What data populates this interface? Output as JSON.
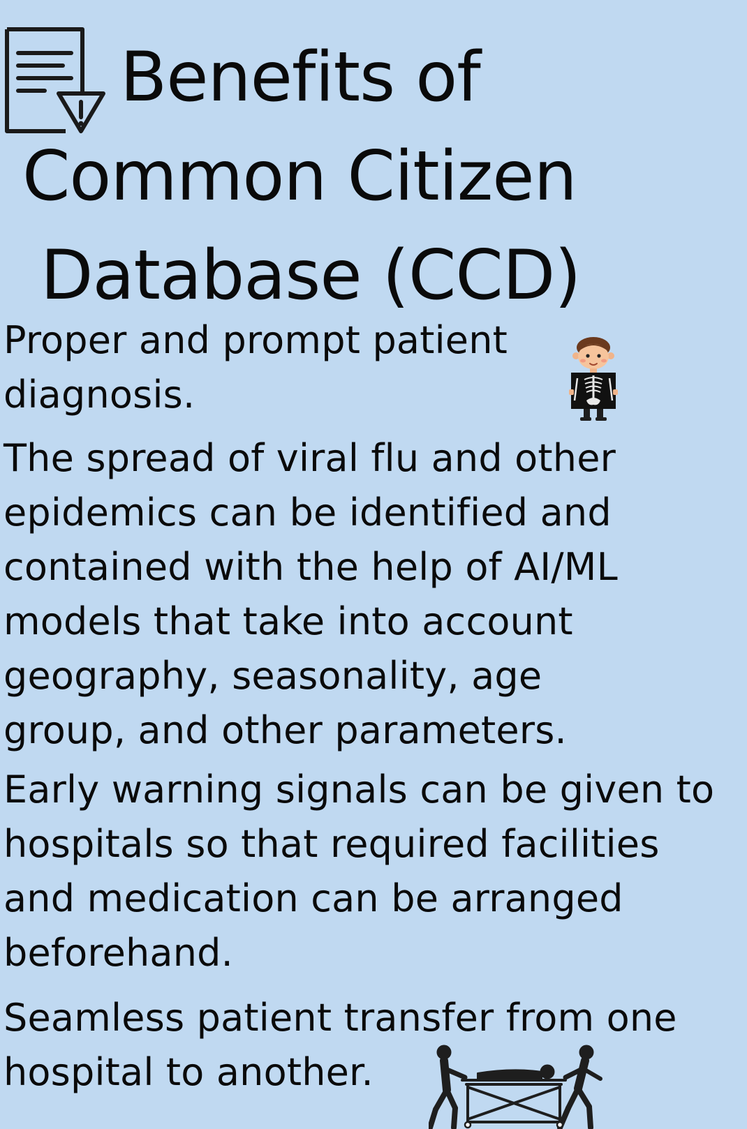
{
  "title": {
    "lines": [
      "Benefits of",
      "Common Citizen",
      "Database (CCD)"
    ]
  },
  "benefits": [
    {
      "lines": [
        "Proper and prompt patient",
        "diagnosis."
      ],
      "icon": "xray-patient-icon"
    },
    {
      "lines": [
        "The spread of viral flu and other",
        "epidemics can be identified and",
        "contained with the help of AI/ML",
        "models that take into account",
        "geography, seasonality, age",
        "group, and other parameters."
      ]
    },
    {
      "lines": [
        "Early warning signals can be given to",
        "hospitals so that required facilities",
        "and medication can be arranged",
        "beforehand."
      ]
    },
    {
      "lines": [
        "Seamless patient transfer from one",
        "hospital to another."
      ],
      "icon": "stretcher-transfer-icon"
    }
  ],
  "header_icon": "document-warning-icon",
  "colors": {
    "background": "#c0d9f1",
    "text": "#0a0a0a"
  }
}
